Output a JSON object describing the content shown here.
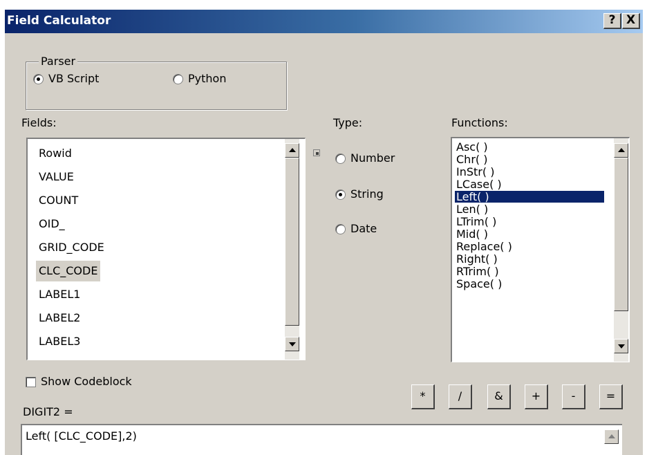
{
  "window": {
    "title": "Field Calculator",
    "help_label": "?",
    "close_label": "X"
  },
  "parser": {
    "legend": "Parser",
    "options": [
      {
        "label": "VB Script",
        "selected": true
      },
      {
        "label": "Python",
        "selected": false
      }
    ]
  },
  "fields": {
    "label": "Fields:",
    "items": [
      "Rowid",
      "VALUE",
      "COUNT",
      "OID_",
      "GRID_CODE",
      "CLC_CODE",
      "LABEL1",
      "LABEL2",
      "LABEL3"
    ],
    "selected": "CLC_CODE"
  },
  "type": {
    "label": "Type:",
    "options": [
      {
        "label": "Number",
        "selected": false
      },
      {
        "label": "String",
        "selected": true
      },
      {
        "label": "Date",
        "selected": false
      }
    ]
  },
  "functions": {
    "label": "Functions:",
    "items": [
      "Asc( )",
      "Chr( )",
      "InStr( )",
      "LCase( )",
      "Left( )",
      "Len( )",
      "LTrim( )",
      "Mid( )",
      "Replace( )",
      "Right( )",
      "RTrim( )",
      "Space( )"
    ],
    "selected": "Left( )"
  },
  "show_codeblock": {
    "label": "Show Codeblock",
    "checked": false
  },
  "operators": [
    "*",
    "/",
    "&",
    "+",
    "-",
    "="
  ],
  "expression": {
    "label": "DIGIT2 =",
    "value": "Left( [CLC_CODE],2)"
  },
  "colors": {
    "title_bar_start": "#0a246a",
    "title_bar_end": "#a6caf0",
    "selection": "#0a246a",
    "dialog_bg": "#d4d0c8"
  }
}
